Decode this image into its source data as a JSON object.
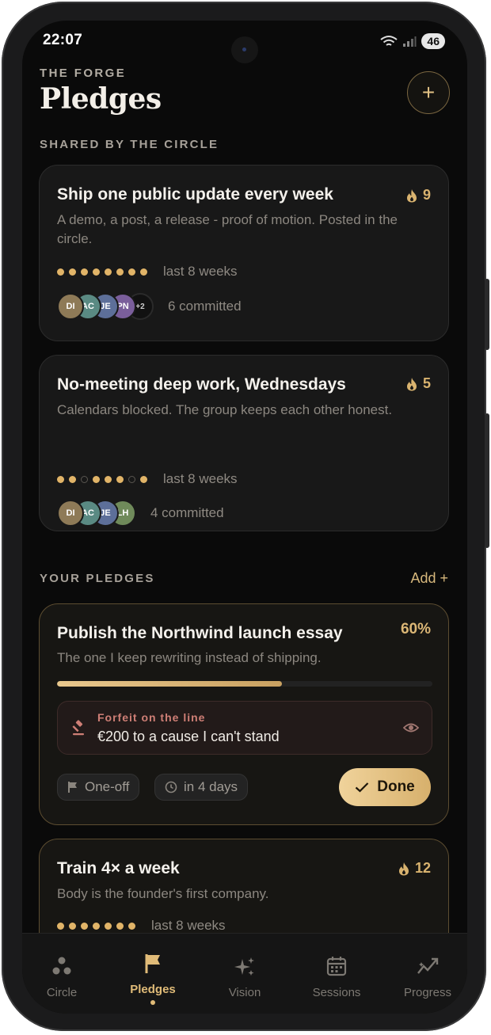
{
  "status_bar": {
    "time": "22:07",
    "battery": "46"
  },
  "header": {
    "eyebrow": "THE FORGE",
    "title": "Pledges",
    "add_symbol": "+"
  },
  "shared_section": {
    "label": "SHARED BY THE CIRCLE",
    "cards": [
      {
        "title": "Ship one public update every week",
        "description": "A demo, a post, a release - proof of motion. Posted in the circle.",
        "streak": "9",
        "history_label": "last 8 weeks",
        "history": [
          1,
          1,
          1,
          1,
          1,
          1,
          1,
          1
        ],
        "avatars": [
          {
            "initials": "DI",
            "color": "#8e7a57"
          },
          {
            "initials": "AC",
            "color": "#5a8a83"
          },
          {
            "initials": "JE",
            "color": "#5d6f99"
          },
          {
            "initials": "PN",
            "color": "#7a5e9b"
          }
        ],
        "more": "+2",
        "committed": "6 committed"
      },
      {
        "title": "No-meeting deep work, Wednesdays",
        "description": "Calendars blocked. The group keeps each other honest.",
        "streak": "5",
        "history_label": "last 8 weeks",
        "history": [
          1,
          1,
          0,
          1,
          1,
          1,
          0,
          1
        ],
        "avatars": [
          {
            "initials": "DI",
            "color": "#8e7a57"
          },
          {
            "initials": "AC",
            "color": "#5a8a83"
          },
          {
            "initials": "JE",
            "color": "#5d6f99"
          },
          {
            "initials": "LH",
            "color": "#6f8a5a"
          }
        ],
        "committed": "4 committed"
      }
    ]
  },
  "your_section": {
    "label": "YOUR PLEDGES",
    "add_label": "Add +",
    "pledge": {
      "title": "Publish the Northwind launch essay",
      "description": "The one I keep rewriting instead of shipping.",
      "percent_label": "60%",
      "progress": 0.6,
      "forfeit_label": "Forfeit on the line",
      "forfeit_text": "€200 to a cause I can't stand",
      "type_label": "One-off",
      "due_label": "in 4 days",
      "done_label": "Done"
    },
    "pledge2": {
      "title": "Train 4× a week",
      "description": "Body is the founder's first company.",
      "streak": "12",
      "history_label": "last 8 weeks",
      "history": [
        1,
        1,
        1,
        1,
        1,
        1,
        1
      ]
    }
  },
  "nav": {
    "items": [
      {
        "label": "Circle",
        "icon": "circle-group-icon"
      },
      {
        "label": "Pledges",
        "icon": "flag-icon"
      },
      {
        "label": "Vision",
        "icon": "sparkle-icon"
      },
      {
        "label": "Sessions",
        "icon": "calendar-icon"
      },
      {
        "label": "Progress",
        "icon": "trend-icon"
      }
    ],
    "active": "Pledges"
  },
  "colors": {
    "accent": "#e0bb78",
    "background": "#0a0a0a",
    "card": "#181818"
  }
}
